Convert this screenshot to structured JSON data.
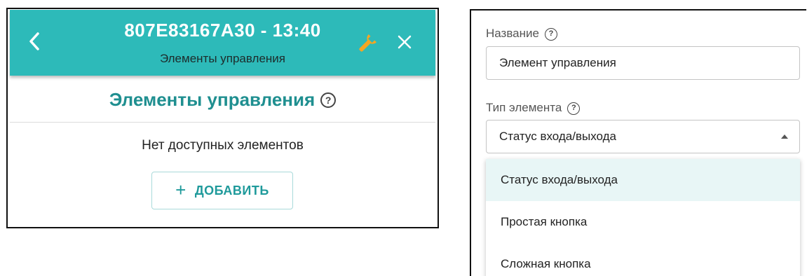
{
  "left_panel": {
    "header": {
      "title": "807E83167A30 - 13:40",
      "subtitle": "Элементы управления",
      "background": "#2dbab9"
    },
    "section_title": "Элементы управления",
    "help_icon_glyph": "?",
    "empty_message": "Нет доступных элементов",
    "add_button": {
      "icon": "+",
      "label": "ДОБАВИТЬ"
    },
    "icons": [
      "back-arrow-icon",
      "wrench-icon",
      "close-icon",
      "help-circle-icon",
      "plus-icon"
    ]
  },
  "right_panel": {
    "name_field": {
      "label": "Название",
      "value": "Элемент управления"
    },
    "type_field": {
      "label": "Тип элемента",
      "selected": "Статус входа/выхода"
    },
    "help_icon_glyph": "?",
    "dropdown_options": [
      "Статус входа/выхода",
      "Простая кнопка",
      "Сложная кнопка"
    ],
    "colors": {
      "accent": "#1f9a9b",
      "selected_option_bg": "#e8f6f6"
    }
  }
}
